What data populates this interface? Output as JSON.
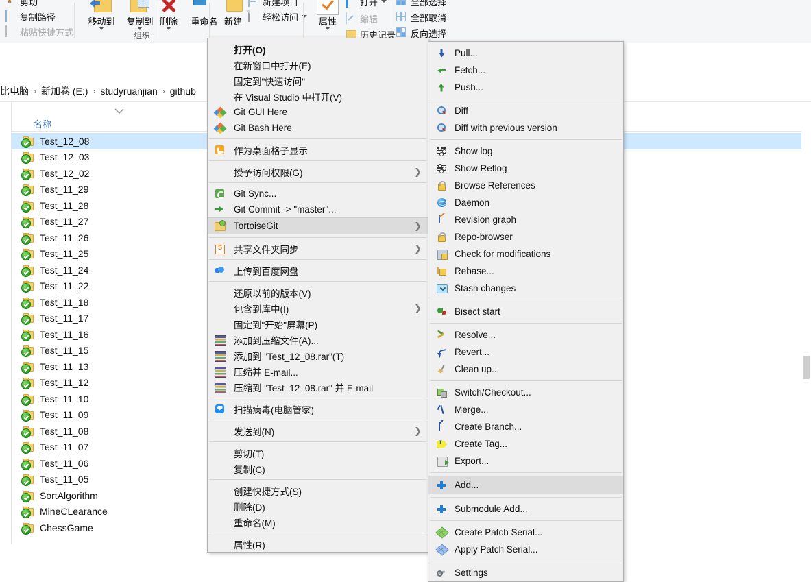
{
  "ribbon": {
    "clipboard_items": [
      {
        "label": "剪切",
        "icon": "scissors-icon",
        "dim": false
      },
      {
        "label": "复制路径",
        "icon": "copy-path-icon",
        "dim": false
      },
      {
        "label": "粘贴快捷方式",
        "icon": "paste-shortcut-icon",
        "dim": true
      }
    ],
    "organize_buttons": [
      {
        "label": "移动到",
        "icon": "move-to-icon",
        "has_caret": true
      },
      {
        "label": "复制到",
        "icon": "copy-to-icon",
        "has_caret": true
      },
      {
        "label": "删除",
        "icon": "delete-icon",
        "has_caret": true
      },
      {
        "label": "重命名",
        "icon": "rename-icon",
        "has_caret": false
      }
    ],
    "organize_group_title": "组织",
    "new_button": {
      "label": "新建",
      "icon": "new-folder-icon"
    },
    "new_items": [
      {
        "label": "新建项目",
        "icon": "new-item-icon",
        "has_caret": false
      },
      {
        "label": "轻松访问",
        "icon": "easy-access-icon",
        "has_caret": true
      }
    ],
    "properties_button": {
      "label": "属性",
      "icon": "properties-check-icon",
      "has_caret": true
    },
    "open_items": [
      {
        "label": "打开",
        "icon": "open-icon",
        "has_caret": true
      },
      {
        "label": "编辑",
        "icon": "edit-icon",
        "dim": true
      },
      {
        "label": "历史记录",
        "icon": "history-icon",
        "dim": false
      }
    ],
    "select_items": [
      {
        "label": "全部选择",
        "icon": "select-all-icon"
      },
      {
        "label": "全部取消",
        "icon": "select-none-icon"
      },
      {
        "label": "反向选择",
        "icon": "invert-selection-icon"
      }
    ]
  },
  "breadcrumb": {
    "separator": "›",
    "items": [
      "比电脑",
      "新加卷 (E:)",
      "studyruanjian",
      "github"
    ]
  },
  "file_pane": {
    "column_header": "名称",
    "files": [
      {
        "name": "Test_12_08",
        "selected": true
      },
      {
        "name": "Test_12_03",
        "selected": false
      },
      {
        "name": "Test_12_02",
        "selected": false
      },
      {
        "name": "Test_11_29",
        "selected": false
      },
      {
        "name": "Test_11_28",
        "selected": false
      },
      {
        "name": "Test_11_27",
        "selected": false
      },
      {
        "name": "Test_11_26",
        "selected": false
      },
      {
        "name": "Test_11_25",
        "selected": false
      },
      {
        "name": "Test_11_24",
        "selected": false
      },
      {
        "name": "Test_11_22",
        "selected": false
      },
      {
        "name": "Test_11_18",
        "selected": false
      },
      {
        "name": "Test_11_17",
        "selected": false
      },
      {
        "name": "Test_11_16",
        "selected": false
      },
      {
        "name": "Test_11_15",
        "selected": false
      },
      {
        "name": "Test_11_13",
        "selected": false
      },
      {
        "name": "Test_11_12",
        "selected": false
      },
      {
        "name": "Test_11_10",
        "selected": false
      },
      {
        "name": "Test_11_09",
        "selected": false
      },
      {
        "name": "Test_11_08",
        "selected": false
      },
      {
        "name": "Test_11_07",
        "selected": false
      },
      {
        "name": "Test_11_06",
        "selected": false
      },
      {
        "name": "Test_11_05",
        "selected": false
      },
      {
        "name": "SortAlgorithm",
        "selected": false
      },
      {
        "name": "MineCLearance",
        "selected": false
      },
      {
        "name": "ChessGame",
        "selected": false
      }
    ]
  },
  "context_menu": {
    "items": [
      {
        "type": "item",
        "label": "打开(O)",
        "icon": "none",
        "bold": true,
        "submenu": false,
        "highlight": false
      },
      {
        "type": "item",
        "label": "在新窗口中打开(E)",
        "icon": "none",
        "bold": false,
        "submenu": false,
        "highlight": false
      },
      {
        "type": "item",
        "label": "固定到\"快速访问\"",
        "icon": "none",
        "bold": false,
        "submenu": false,
        "highlight": false
      },
      {
        "type": "item",
        "label": "在 Visual Studio 中打开(V)",
        "icon": "none",
        "bold": false,
        "submenu": false,
        "highlight": false
      },
      {
        "type": "item",
        "label": "Git GUI Here",
        "icon": "git-logo-icon",
        "bold": false,
        "submenu": false,
        "highlight": false
      },
      {
        "type": "item",
        "label": "Git Bash Here",
        "icon": "git-logo-icon",
        "bold": false,
        "submenu": false,
        "highlight": false
      },
      {
        "type": "sep"
      },
      {
        "type": "item",
        "label": "作为桌面格子显示",
        "icon": "desktop-tile-icon",
        "bold": false,
        "submenu": false,
        "highlight": false
      },
      {
        "type": "sep"
      },
      {
        "type": "item",
        "label": "授予访问权限(G)",
        "icon": "none",
        "bold": false,
        "submenu": true,
        "highlight": false
      },
      {
        "type": "sep"
      },
      {
        "type": "item",
        "label": "Git Sync...",
        "icon": "git-sync-icon",
        "bold": false,
        "submenu": false,
        "highlight": false
      },
      {
        "type": "item",
        "label": "Git Commit -> \"master\"...",
        "icon": "git-commit-icon",
        "bold": false,
        "submenu": false,
        "highlight": false
      },
      {
        "type": "item",
        "label": "TortoiseGit",
        "icon": "tortoisegit-icon",
        "bold": false,
        "submenu": true,
        "highlight": true
      },
      {
        "type": "sep"
      },
      {
        "type": "item",
        "label": "共享文件夹同步",
        "icon": "share-folder-sync-icon",
        "bold": false,
        "submenu": true,
        "highlight": false
      },
      {
        "type": "sep"
      },
      {
        "type": "item",
        "label": "上传到百度网盘",
        "icon": "baidu-netdisk-icon",
        "bold": false,
        "submenu": false,
        "highlight": false
      },
      {
        "type": "sep"
      },
      {
        "type": "item",
        "label": "还原以前的版本(V)",
        "icon": "none",
        "bold": false,
        "submenu": false,
        "highlight": false
      },
      {
        "type": "item",
        "label": "包含到库中(I)",
        "icon": "none",
        "bold": false,
        "submenu": true,
        "highlight": false
      },
      {
        "type": "item",
        "label": "固定到\"开始\"屏幕(P)",
        "icon": "none",
        "bold": false,
        "submenu": false,
        "highlight": false
      },
      {
        "type": "item",
        "label": "添加到压缩文件(A)...",
        "icon": "winrar-icon",
        "bold": false,
        "submenu": false,
        "highlight": false
      },
      {
        "type": "item",
        "label": "添加到 \"Test_12_08.rar\"(T)",
        "icon": "winrar-icon",
        "bold": false,
        "submenu": false,
        "highlight": false
      },
      {
        "type": "item",
        "label": "压缩并 E-mail...",
        "icon": "winrar-icon",
        "bold": false,
        "submenu": false,
        "highlight": false
      },
      {
        "type": "item",
        "label": "压缩到 \"Test_12_08.rar\" 并 E-mail",
        "icon": "winrar-icon",
        "bold": false,
        "submenu": false,
        "highlight": false
      },
      {
        "type": "sep"
      },
      {
        "type": "item",
        "label": "扫描病毒(电脑管家)",
        "icon": "antivirus-shield-icon",
        "bold": false,
        "submenu": false,
        "highlight": false
      },
      {
        "type": "sep"
      },
      {
        "type": "item",
        "label": "发送到(N)",
        "icon": "none",
        "bold": false,
        "submenu": true,
        "highlight": false
      },
      {
        "type": "sep"
      },
      {
        "type": "item",
        "label": "剪切(T)",
        "icon": "none",
        "bold": false,
        "submenu": false,
        "highlight": false
      },
      {
        "type": "item",
        "label": "复制(C)",
        "icon": "none",
        "bold": false,
        "submenu": false,
        "highlight": false
      },
      {
        "type": "sep"
      },
      {
        "type": "item",
        "label": "创建快捷方式(S)",
        "icon": "none",
        "bold": false,
        "submenu": false,
        "highlight": false
      },
      {
        "type": "item",
        "label": "删除(D)",
        "icon": "none",
        "bold": false,
        "submenu": false,
        "highlight": false
      },
      {
        "type": "item",
        "label": "重命名(M)",
        "icon": "none",
        "bold": false,
        "submenu": false,
        "highlight": false
      },
      {
        "type": "sep"
      },
      {
        "type": "item",
        "label": "属性(R)",
        "icon": "none",
        "bold": false,
        "submenu": false,
        "highlight": false
      }
    ]
  },
  "tortoisegit_submenu": {
    "items": [
      {
        "type": "item",
        "label": "Pull...",
        "icon": "pull-icon",
        "highlight": false
      },
      {
        "type": "item",
        "label": "Fetch...",
        "icon": "fetch-icon",
        "highlight": false
      },
      {
        "type": "item",
        "label": "Push...",
        "icon": "push-icon",
        "highlight": false
      },
      {
        "type": "sep"
      },
      {
        "type": "item",
        "label": "Diff",
        "icon": "diff-icon",
        "highlight": false
      },
      {
        "type": "item",
        "label": "Diff with previous version",
        "icon": "diff-icon",
        "highlight": false
      },
      {
        "type": "sep"
      },
      {
        "type": "item",
        "label": "Show log",
        "icon": "show-log-icon",
        "highlight": false
      },
      {
        "type": "item",
        "label": "Show Reflog",
        "icon": "show-log-icon",
        "highlight": false
      },
      {
        "type": "item",
        "label": "Browse References",
        "icon": "browse-references-icon",
        "highlight": false
      },
      {
        "type": "item",
        "label": "Daemon",
        "icon": "daemon-globe-icon",
        "highlight": false
      },
      {
        "type": "item",
        "label": "Revision graph",
        "icon": "revision-graph-icon",
        "highlight": false
      },
      {
        "type": "item",
        "label": "Repo-browser",
        "icon": "repo-browser-icon",
        "highlight": false
      },
      {
        "type": "item",
        "label": "Check for modifications",
        "icon": "check-modifications-icon",
        "highlight": false
      },
      {
        "type": "item",
        "label": "Rebase...",
        "icon": "rebase-icon",
        "highlight": false
      },
      {
        "type": "item",
        "label": "Stash changes",
        "icon": "stash-icon",
        "highlight": false
      },
      {
        "type": "sep"
      },
      {
        "type": "item",
        "label": "Bisect start",
        "icon": "bisect-icon",
        "highlight": false
      },
      {
        "type": "sep"
      },
      {
        "type": "item",
        "label": "Resolve...",
        "icon": "resolve-icon",
        "highlight": false
      },
      {
        "type": "item",
        "label": "Revert...",
        "icon": "revert-icon",
        "highlight": false
      },
      {
        "type": "item",
        "label": "Clean up...",
        "icon": "cleanup-broom-icon",
        "highlight": false
      },
      {
        "type": "sep"
      },
      {
        "type": "item",
        "label": "Switch/Checkout...",
        "icon": "switch-checkout-icon",
        "highlight": false
      },
      {
        "type": "item",
        "label": "Merge...",
        "icon": "merge-icon",
        "highlight": false
      },
      {
        "type": "item",
        "label": "Create Branch...",
        "icon": "create-branch-icon",
        "highlight": false
      },
      {
        "type": "item",
        "label": "Create Tag...",
        "icon": "create-tag-icon",
        "highlight": false
      },
      {
        "type": "item",
        "label": "Export...",
        "icon": "export-icon",
        "highlight": false
      },
      {
        "type": "sep"
      },
      {
        "type": "item",
        "label": "Add...",
        "icon": "add-plus-icon",
        "highlight": true
      },
      {
        "type": "sep"
      },
      {
        "type": "item",
        "label": "Submodule Add...",
        "icon": "add-plus-icon",
        "highlight": false
      },
      {
        "type": "sep"
      },
      {
        "type": "item",
        "label": "Create Patch Serial...",
        "icon": "create-patch-icon",
        "highlight": false
      },
      {
        "type": "item",
        "label": "Apply Patch Serial...",
        "icon": "apply-patch-icon",
        "highlight": false
      },
      {
        "type": "sep"
      },
      {
        "type": "item",
        "label": "Settings",
        "icon": "settings-wrench-icon",
        "highlight": false
      }
    ]
  },
  "colors": {
    "selection_blue": "#cde8ff",
    "menu_bg": "#f0f0f0",
    "menu_highlight": "#dcdcdc",
    "breadcrumb_link": "#111111",
    "column_header_text": "#3a6ea5"
  }
}
